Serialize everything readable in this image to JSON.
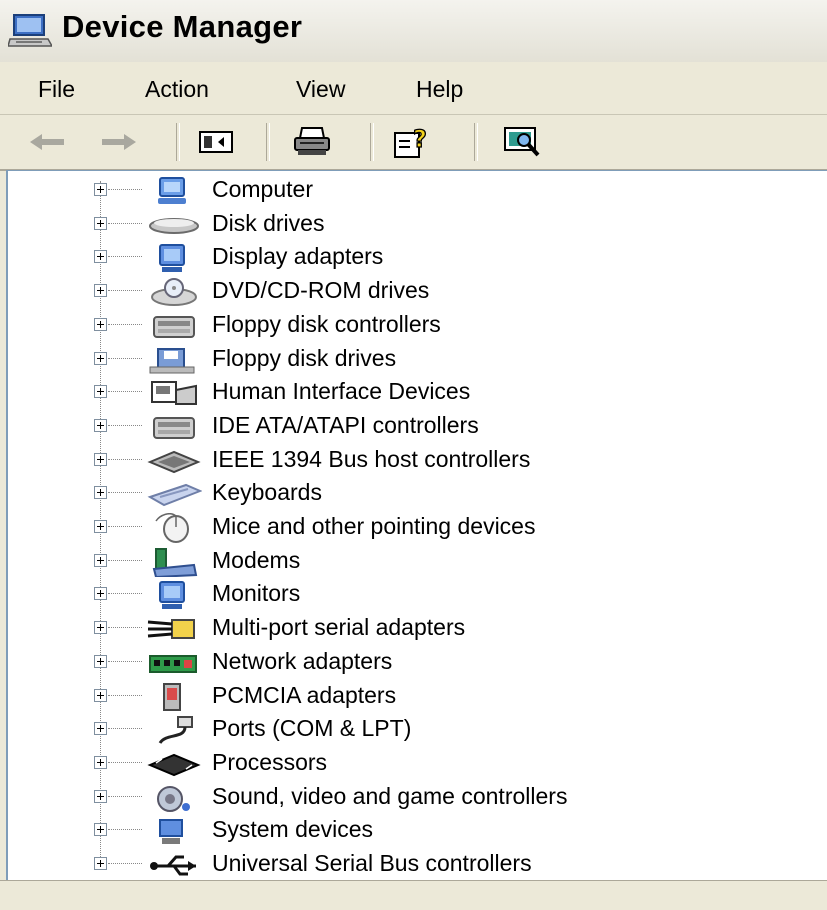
{
  "window": {
    "title": "Device Manager"
  },
  "menu": [
    "File",
    "Action",
    "View",
    "Help"
  ],
  "toolbar": {
    "back_icon": "arrow-left-icon",
    "forward_icon": "arrow-right-icon",
    "show_hide_icon": "console-tree-icon",
    "print_icon": "printer-icon",
    "help_icon": "help-icon",
    "properties_icon": "scan-hardware-icon"
  },
  "tree": {
    "items": [
      {
        "label": "Computer",
        "icon": "computer-icon"
      },
      {
        "label": "Disk drives",
        "icon": "disk-drive-icon"
      },
      {
        "label": "Display adapters",
        "icon": "display-adapter-icon"
      },
      {
        "label": "DVD/CD-ROM drives",
        "icon": "cdrom-icon"
      },
      {
        "label": "Floppy disk controllers",
        "icon": "floppy-controller-icon"
      },
      {
        "label": "Floppy disk drives",
        "icon": "floppy-drive-icon"
      },
      {
        "label": "Human Interface Devices",
        "icon": "hid-icon"
      },
      {
        "label": "IDE ATA/ATAPI controllers",
        "icon": "ide-controller-icon"
      },
      {
        "label": "IEEE 1394 Bus host controllers",
        "icon": "ieee1394-icon"
      },
      {
        "label": "Keyboards",
        "icon": "keyboard-icon"
      },
      {
        "label": "Mice and other pointing devices",
        "icon": "mouse-icon"
      },
      {
        "label": "Modems",
        "icon": "modem-icon"
      },
      {
        "label": "Monitors",
        "icon": "monitor-icon"
      },
      {
        "label": "Multi-port serial adapters",
        "icon": "serial-adapter-icon"
      },
      {
        "label": "Network adapters",
        "icon": "network-adapter-icon"
      },
      {
        "label": "PCMCIA adapters",
        "icon": "pcmcia-icon"
      },
      {
        "label": "Ports (COM & LPT)",
        "icon": "port-icon"
      },
      {
        "label": "Processors",
        "icon": "processor-icon"
      },
      {
        "label": "Sound, video and game controllers",
        "icon": "sound-icon"
      },
      {
        "label": "System devices",
        "icon": "system-device-icon"
      },
      {
        "label": "Universal Serial Bus controllers",
        "icon": "usb-icon"
      }
    ]
  }
}
